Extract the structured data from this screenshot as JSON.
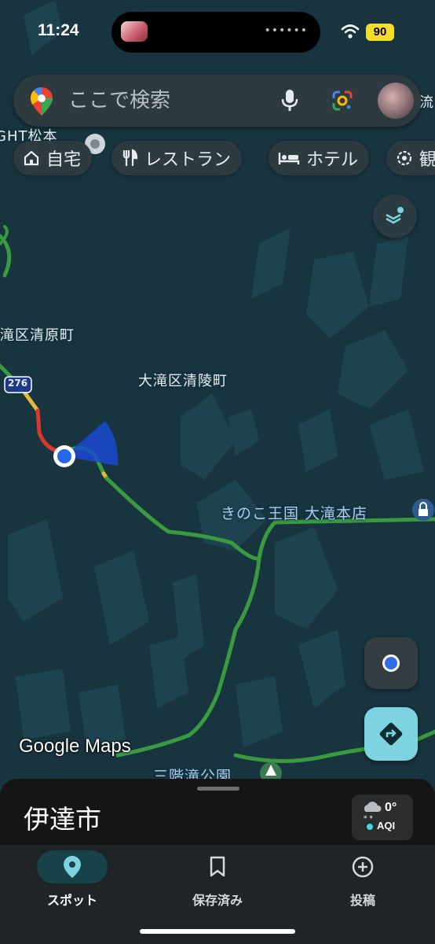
{
  "status_bar": {
    "time": "11:24",
    "battery": "90"
  },
  "search": {
    "placeholder": "ここで検索"
  },
  "chips": [
    {
      "label": "自宅",
      "icon": "home-icon"
    },
    {
      "label": "レストラン",
      "icon": "restaurant-icon"
    },
    {
      "label": "ホテル",
      "icon": "hotel-icon"
    },
    {
      "label": "観",
      "icon": "attraction-icon"
    }
  ],
  "map": {
    "labels": {
      "top_left_partial": "GHT松本",
      "top_right_partial": "流",
      "kiyohara": "滝区清原町",
      "seiryo": "大滝区清陵町",
      "route_number": "276",
      "kinoko": "きのこ王国 大滝本店",
      "sanriku": "三階滝公園"
    },
    "colors": {
      "background": "#17343f",
      "road": "#3a9a3f",
      "poi_text": "#a8cdf0"
    }
  },
  "brand": {
    "logo_text": "Google Maps"
  },
  "sheet": {
    "title": "伊達市",
    "weather_temp": "0°",
    "weather_aqi": "AQI"
  },
  "nav": [
    {
      "label": "スポット",
      "icon": "location-pin-icon",
      "active": true
    },
    {
      "label": "保存済み",
      "icon": "bookmark-icon",
      "active": false
    },
    {
      "label": "投稿",
      "icon": "add-circle-icon",
      "active": false
    }
  ]
}
